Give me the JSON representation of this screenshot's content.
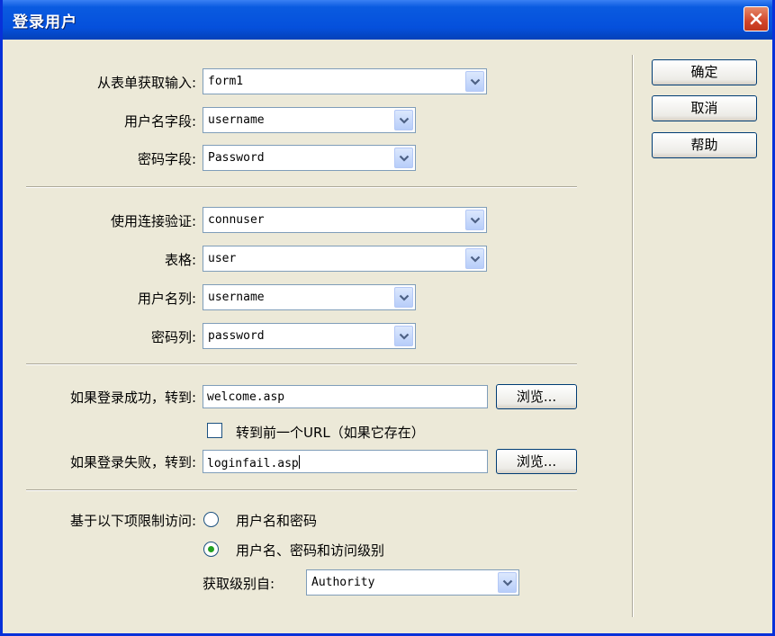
{
  "window": {
    "title": "登录用户"
  },
  "form": {
    "form_label": "从表单获取输入:",
    "form_value": "form1",
    "username_field_label": "用户名字段:",
    "username_field_value": "username",
    "password_field_label": "密码字段:",
    "password_field_value": "Password"
  },
  "connection": {
    "conn_label": "使用连接验证:",
    "conn_value": "connuser",
    "table_label": "表格:",
    "table_value": "user",
    "username_col_label": "用户名列:",
    "username_col_value": "username",
    "password_col_label": "密码列:",
    "password_col_value": "password"
  },
  "redirect": {
    "success_label": "如果登录成功，转到:",
    "success_value": "welcome.asp",
    "browse_label": "浏览...",
    "prev_url_label": "转到前一个URL（如果它存在）",
    "prev_url_checked": false,
    "fail_label": "如果登录失败，转到:",
    "fail_value": "loginfail.asp"
  },
  "restrict": {
    "label": "基于以下项限制访问:",
    "option1": "用户名和密码",
    "option2": "用户名、密码和访问级别",
    "selected": "option2",
    "level_label": "获取级别自:",
    "level_value": "Authority"
  },
  "buttons": {
    "ok": "确定",
    "cancel": "取消",
    "help": "帮助"
  }
}
